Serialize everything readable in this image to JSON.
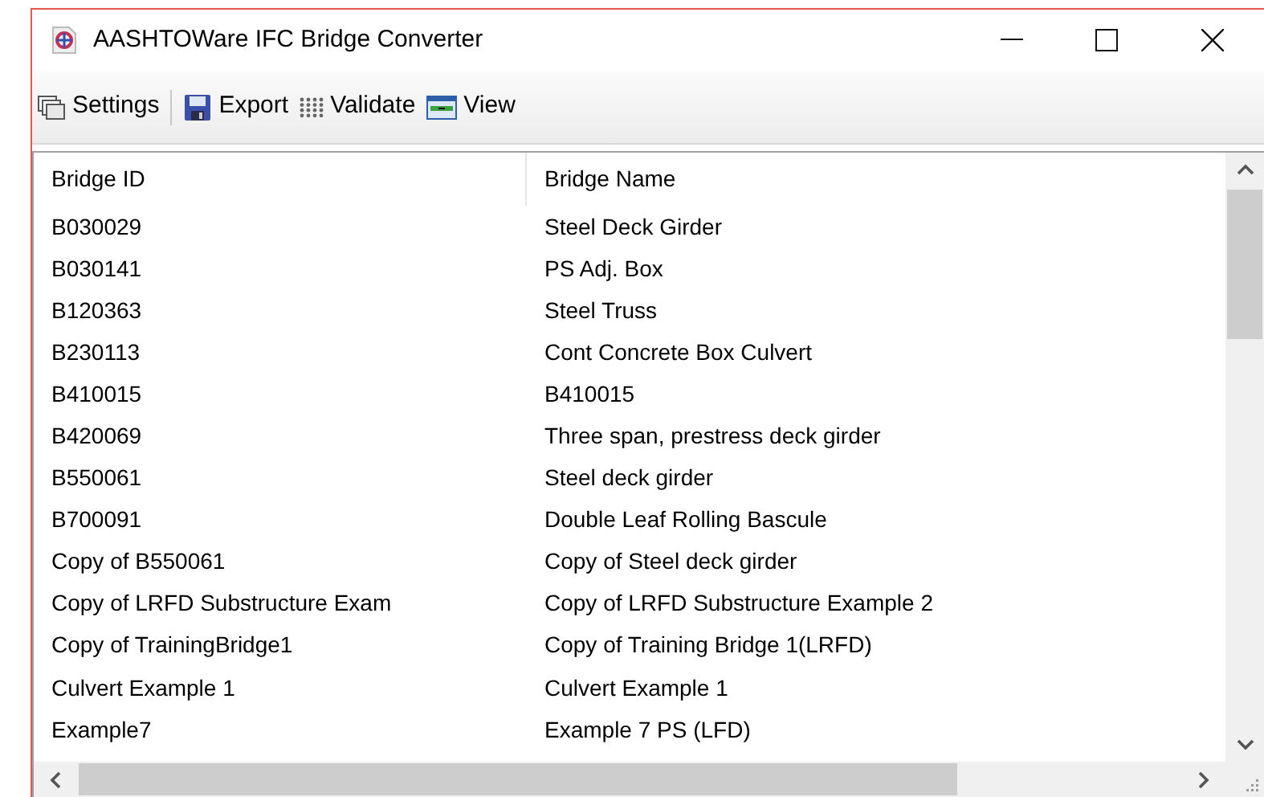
{
  "window": {
    "title": "AASHTOWare IFC Bridge Converter"
  },
  "toolbar": [
    {
      "label": "Settings",
      "kind": "settings"
    },
    {
      "label": "Export",
      "kind": "export"
    },
    {
      "label": "Validate",
      "kind": "validate"
    },
    {
      "label": "View",
      "kind": "view"
    }
  ],
  "table": {
    "columns": [
      "Bridge ID",
      "Bridge Name"
    ],
    "rows": [
      [
        "B030029",
        "Steel Deck Girder"
      ],
      [
        "B030141",
        "PS Adj. Box"
      ],
      [
        "B120363",
        "Steel Truss"
      ],
      [
        "B230113",
        "Cont Concrete Box Culvert"
      ],
      [
        "B410015",
        "B410015"
      ],
      [
        "B420069",
        "Three span, prestress deck girder"
      ],
      [
        "B550061",
        "Steel deck girder"
      ],
      [
        "B700091",
        "Double Leaf Rolling Bascule"
      ],
      [
        "Copy of B550061",
        "Copy of Steel deck girder"
      ],
      [
        "Copy of LRFD Substructure Exam",
        "Copy of LRFD Substructure Example 2"
      ],
      [
        "Copy of TrainingBridge1",
        "Copy of Training Bridge 1(LRFD)"
      ],
      [
        "Culvert Example 1",
        "Culvert Example 1"
      ],
      [
        "Example7",
        "Example 7 PS (LFD)"
      ]
    ]
  }
}
